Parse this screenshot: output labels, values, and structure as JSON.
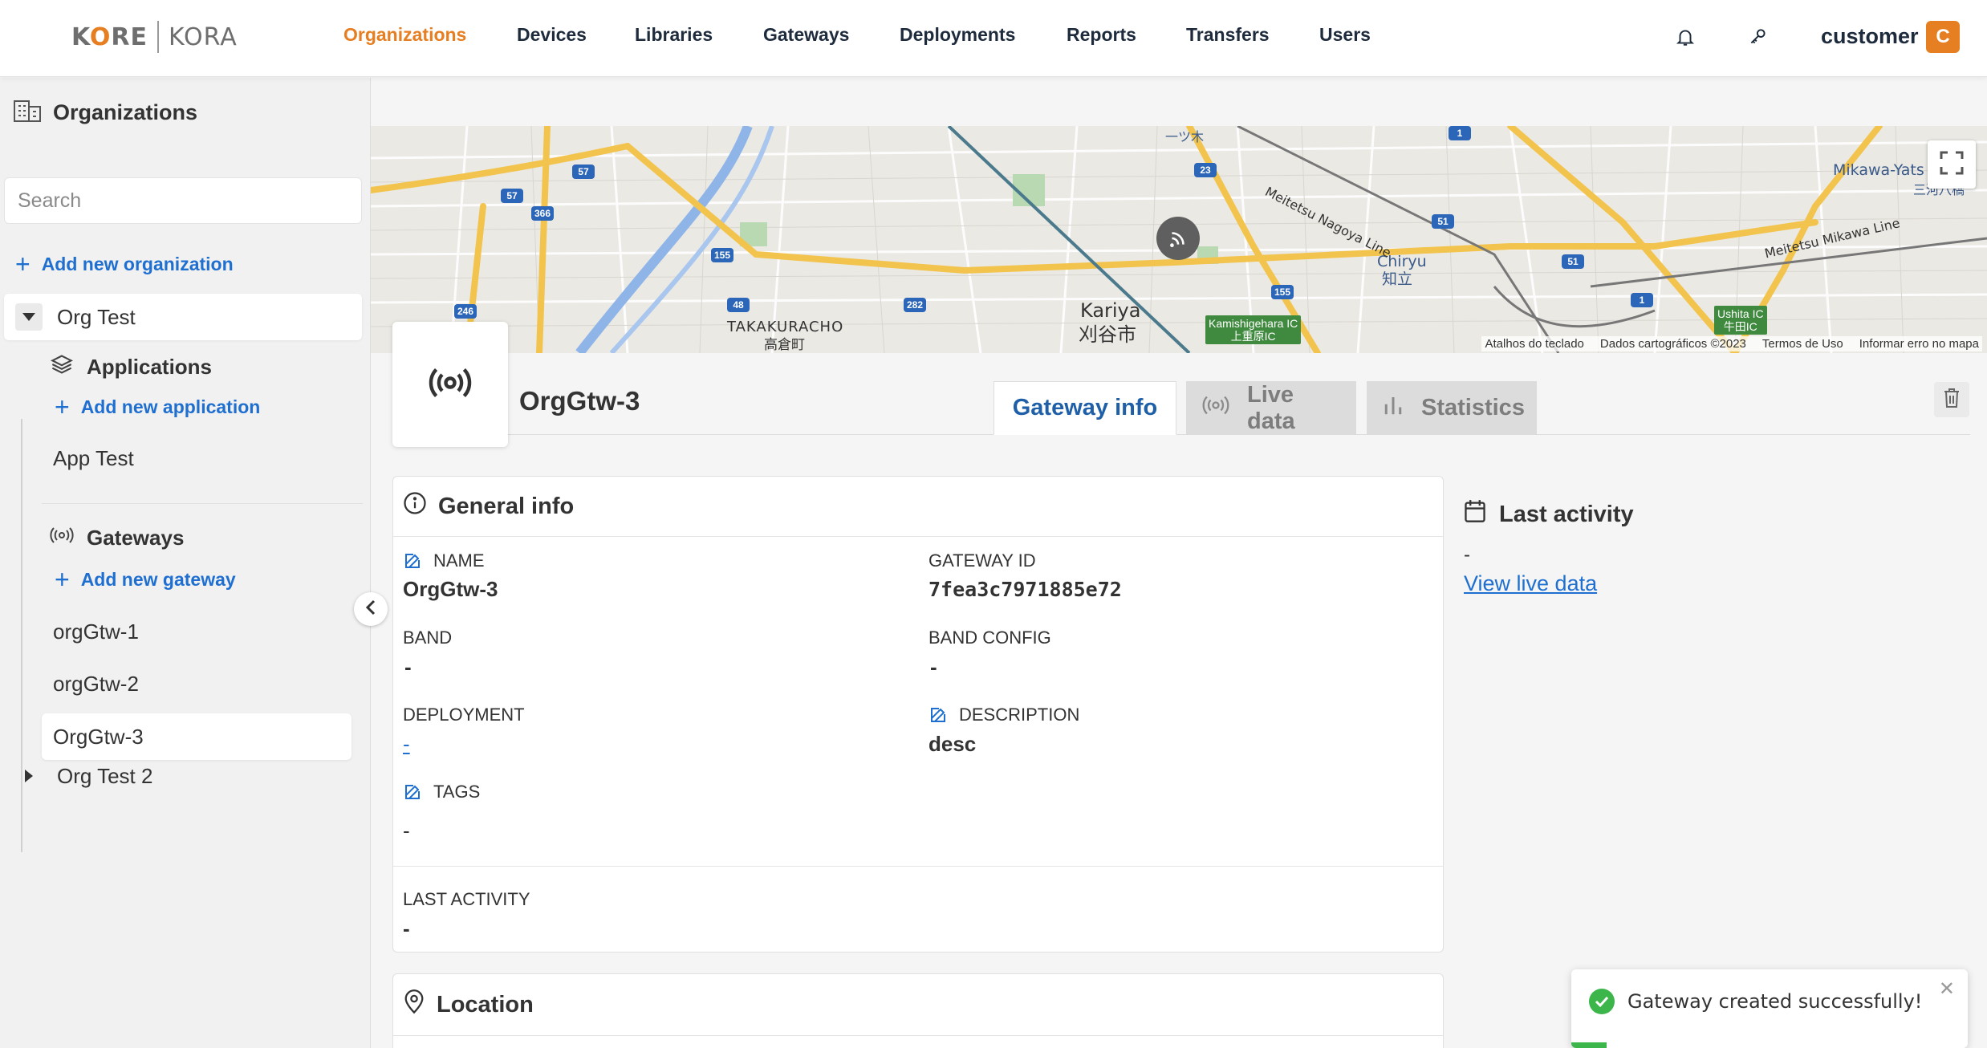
{
  "brand": {
    "left": "KORE",
    "right": "KORA"
  },
  "nav": {
    "items": [
      {
        "label": "Organizations",
        "active": true
      },
      {
        "label": "Devices"
      },
      {
        "label": "Libraries"
      },
      {
        "label": "Gateways"
      },
      {
        "label": "Deployments"
      },
      {
        "label": "Reports"
      },
      {
        "label": "Transfers"
      },
      {
        "label": "Users"
      }
    ],
    "icons": [
      "bell-icon",
      "key-icon"
    ],
    "user": {
      "name": "customer",
      "initial": "C"
    }
  },
  "sidebar": {
    "title": "Organizations",
    "title_icon": "building-icon",
    "search_placeholder": "Search",
    "add_org_label": "Add new organization",
    "orgs": [
      {
        "name": "Org Test",
        "expanded": true,
        "applications": {
          "title": "Applications",
          "icon": "layers-icon",
          "add_label": "Add new application",
          "items": [
            "App Test"
          ]
        },
        "gateways": {
          "title": "Gateways",
          "icon": "broadcast-icon",
          "add_label": "Add new gateway",
          "items": [
            "orgGtw-1",
            "orgGtw-2",
            "OrgGtw-3"
          ],
          "selected": "OrgGtw-3"
        }
      },
      {
        "name": "Org Test 2",
        "expanded": false
      }
    ]
  },
  "map": {
    "places": {
      "kariya_en": "Kariya",
      "kariya_jp": "刈谷市",
      "takakuracho_en": "TAKAKURACHO",
      "takakuracho_jp": "高倉町",
      "chiryu_en": "Chiryu",
      "chiryu_jp": "知立",
      "mikawa": "Mikawa-Yats",
      "mikawa_jp": "三河八橋",
      "meitetsu_nagoya": "Meitetsu Nagoya Line",
      "meitetsu_mikawa": "Meitetsu Mikawa Line",
      "hitotsugi": "一ツ木",
      "kamishigehara_en": "Kamishigehara IC",
      "kamishigehara_jp": "上重原IC",
      "ushita_en": "Ushita IC",
      "ushita_jp": "牛田IC"
    },
    "routes": [
      "57",
      "57",
      "366",
      "155",
      "246",
      "48",
      "282",
      "23",
      "155",
      "51",
      "51",
      "1",
      "1"
    ],
    "attribution": [
      "Atalhos do teclado",
      "Dados cartográficos ©2023",
      "Termos de Uso",
      "Informar erro no mapa"
    ]
  },
  "gateway": {
    "title": "OrgGtw-3",
    "icon": "broadcast-icon",
    "tabs": [
      {
        "label": "Gateway info",
        "active": true
      },
      {
        "label": "Live data",
        "icon": "broadcast-icon",
        "disabled": true
      },
      {
        "label": "Statistics",
        "icon": "bar-chart-icon",
        "disabled": true
      }
    ],
    "general": {
      "title": "General info",
      "fields": {
        "name": {
          "label": "NAME",
          "value": "OrgGtw-3",
          "editable": true
        },
        "gateway_id": {
          "label": "GATEWAY ID",
          "value": "7fea3c7971885e72"
        },
        "band": {
          "label": "BAND",
          "value": "-"
        },
        "band_config": {
          "label": "BAND CONFIG",
          "value": "-"
        },
        "deployment": {
          "label": "DEPLOYMENT",
          "value": "-"
        },
        "description": {
          "label": "DESCRIPTION",
          "value": "desc",
          "editable": true
        },
        "tags": {
          "label": "TAGS",
          "value": "-",
          "editable": true
        },
        "last_activity": {
          "label": "LAST ACTIVITY",
          "value": "-"
        }
      }
    },
    "location": {
      "title": "Location"
    },
    "last_activity": {
      "title": "Last activity",
      "value": "-",
      "link": "View live data"
    }
  },
  "toast": {
    "message": "Gateway created successfully!",
    "type": "success",
    "progress": 0.09
  },
  "colors": {
    "accent": "#e67e22",
    "link": "#1f6fd1",
    "success": "#3cb54a",
    "tab_active": "#1e5fa8"
  }
}
